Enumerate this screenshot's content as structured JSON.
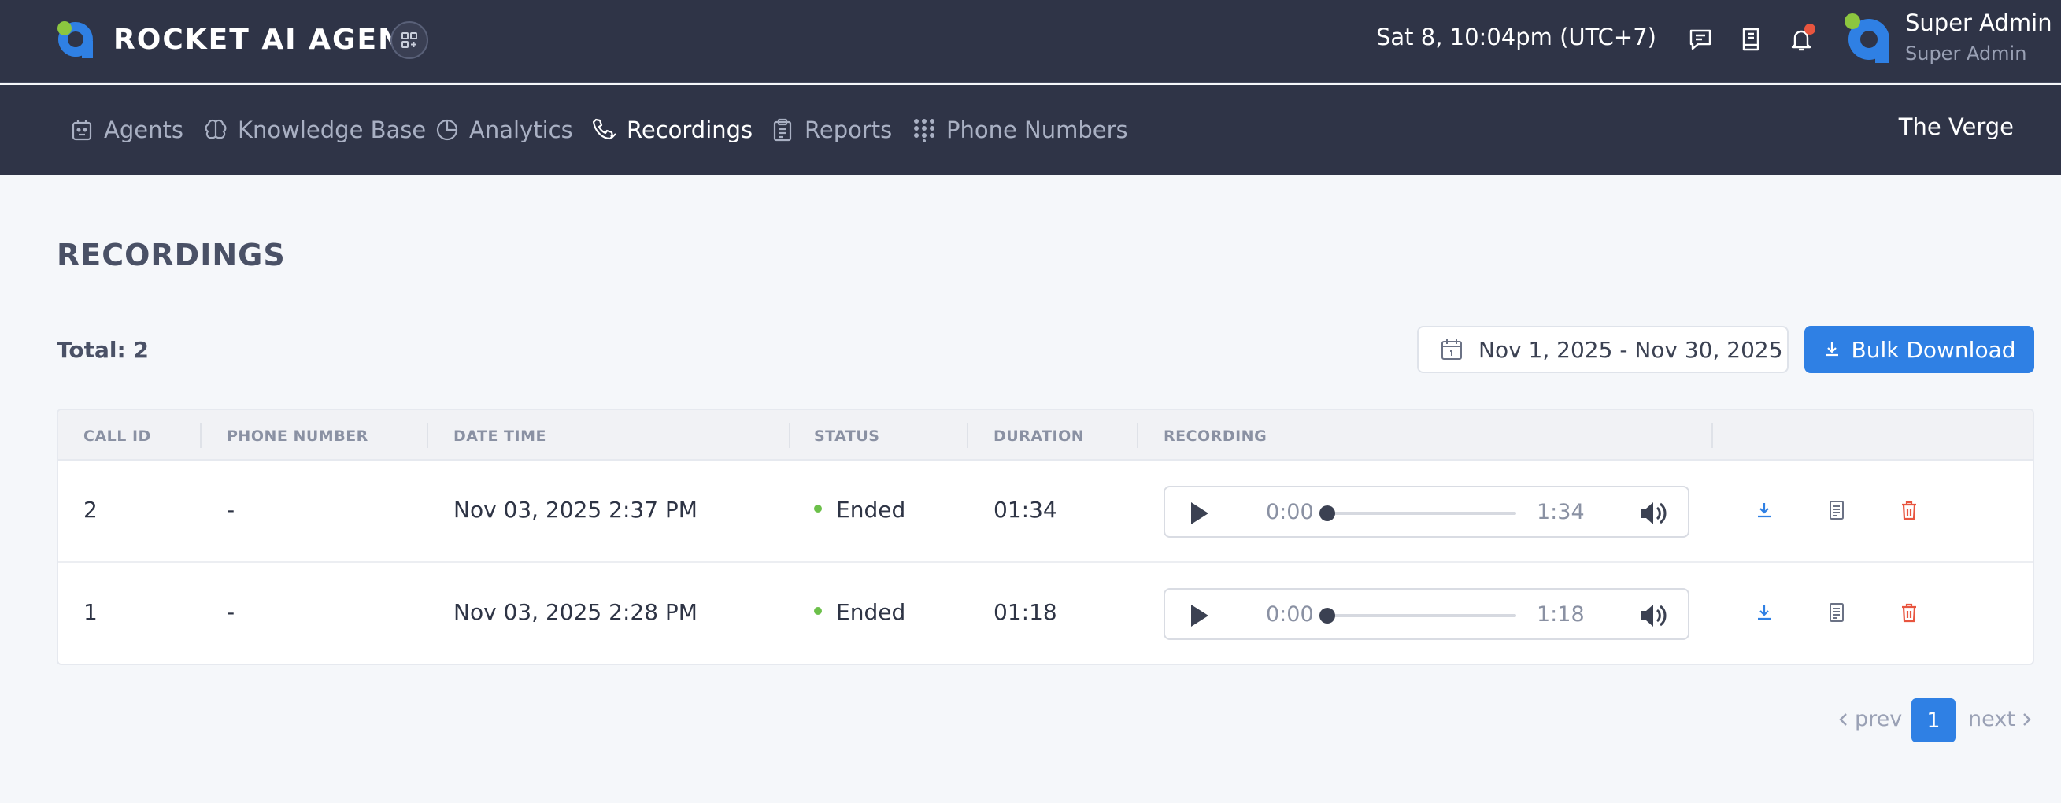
{
  "header": {
    "brand": "ROCKET AI AGENT",
    "datetime": "Sat 8, 10:04pm (UTC+7)",
    "user_name": "Super Admin",
    "user_role": "Super Admin",
    "notification_badge": true
  },
  "nav": {
    "items": [
      {
        "label": "Agents",
        "icon": "agent-icon"
      },
      {
        "label": "Knowledge Base",
        "icon": "brain-icon"
      },
      {
        "label": "Analytics",
        "icon": "pie-chart-icon"
      },
      {
        "label": "Recordings",
        "icon": "phone-icon",
        "active": true
      },
      {
        "label": "Reports",
        "icon": "clipboard-icon"
      },
      {
        "label": "Phone Numbers",
        "icon": "dialpad-icon"
      }
    ],
    "org": "The Verge"
  },
  "page": {
    "title": "RECORDINGS",
    "total": "Total: 2",
    "date_range": "Nov 1, 2025 - Nov 30, 2025",
    "bulk_download": "Bulk Download"
  },
  "table": {
    "columns": [
      "CALL ID",
      "PHONE NUMBER",
      "DATE TIME",
      "STATUS",
      "DURATION",
      "RECORDING"
    ],
    "rows": [
      {
        "call_id": "2",
        "phone": "-",
        "datetime": "Nov 03, 2025 2:37 PM",
        "status": "Ended",
        "duration": "01:34",
        "current": "0:00",
        "total": "1:34"
      },
      {
        "call_id": "1",
        "phone": "-",
        "datetime": "Nov 03, 2025 2:28 PM",
        "status": "Ended",
        "duration": "01:18",
        "current": "0:00",
        "total": "1:18"
      }
    ]
  },
  "pagination": {
    "prev": "prev",
    "current": "1",
    "next": "next"
  },
  "colors": {
    "header_bg": "#2f3447",
    "accent": "#2f80e4",
    "status_ended": "#6cc04a",
    "delete": "#e8553f"
  }
}
